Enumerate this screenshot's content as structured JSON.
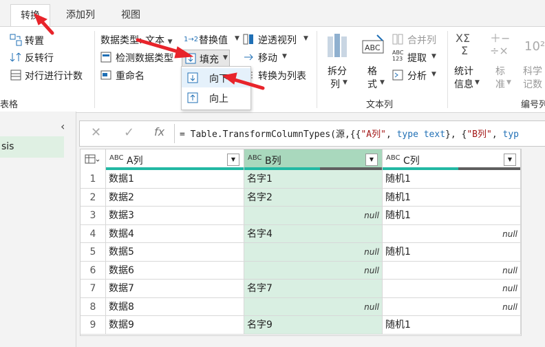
{
  "tabs": [
    {
      "label": "转换",
      "active": true
    },
    {
      "label": "添加列",
      "active": false
    },
    {
      "label": "视图",
      "active": false
    }
  ],
  "ribbon": {
    "table_group": {
      "transpose": "转置",
      "reverse_rows": "反转行",
      "count_rows": "对行进行计数",
      "group_label": "表格"
    },
    "any_column": {
      "data_type": "数据类型: 文本",
      "detect_type": "检测数据类型",
      "rename": "重命名",
      "replace_values": "替换值",
      "fill": "填充",
      "unpivot": "逆透视列",
      "move": "移动",
      "to_list": "转换为列表"
    },
    "text_column": {
      "split": "拆分\n列",
      "split_l1": "拆分",
      "split_l2": "列",
      "format_l1": "格",
      "format_l2": "式",
      "merge": "合并列",
      "extract": "提取",
      "parse": "分析",
      "group_label": "文本列",
      "abc123": "ABC\n123"
    },
    "number_column": {
      "stats_l1": "统计",
      "stats_l2": "信息",
      "standard_l1": "标",
      "standard_l2": "准",
      "sci_l1": "科学",
      "sci_l2": "记数",
      "group_label": "编号列",
      "sci_icon": "10²"
    }
  },
  "fill_menu": {
    "down": "向下",
    "up": "向上"
  },
  "left_panel": {
    "query_name": "sis",
    "collapse_icon": "chevron-left-icon"
  },
  "formula_bar": {
    "prefix": "= Table.TransformColumnTypes(源,{{",
    "a": "\"A列\"",
    "sep1": ", ",
    "type1": "type text",
    "mid": "}, {",
    "b": "\"B列\"",
    "sep2": ", ",
    "type2": "typ",
    "fx": "fx"
  },
  "grid": {
    "columns": [
      {
        "name": "A列",
        "type_icon": "ABC"
      },
      {
        "name": "B列",
        "type_icon": "ABC",
        "selected": true
      },
      {
        "name": "C列",
        "type_icon": "ABC"
      }
    ],
    "rows": [
      {
        "n": "1",
        "a": "数据1",
        "b": "名字1",
        "c": "随机1"
      },
      {
        "n": "2",
        "a": "数据2",
        "b": "名字2",
        "c": "随机1"
      },
      {
        "n": "3",
        "a": "数据3",
        "b": "null",
        "c": "随机1"
      },
      {
        "n": "4",
        "a": "数据4",
        "b": "名字4",
        "c": "null"
      },
      {
        "n": "5",
        "a": "数据5",
        "b": "null",
        "c": "随机1"
      },
      {
        "n": "6",
        "a": "数据6",
        "b": "null",
        "c": "null"
      },
      {
        "n": "7",
        "a": "数据7",
        "b": "名字7",
        "c": "null"
      },
      {
        "n": "8",
        "a": "数据8",
        "b": "null",
        "c": "null"
      },
      {
        "n": "9",
        "a": "数据9",
        "b": "名字9",
        "c": "随机1"
      }
    ]
  },
  "colors": {
    "accent_teal": "#22b8a3",
    "selected_column": "#d9efe2",
    "selected_header": "#a9d8bd",
    "annotation_arrow": "#e8242b"
  }
}
